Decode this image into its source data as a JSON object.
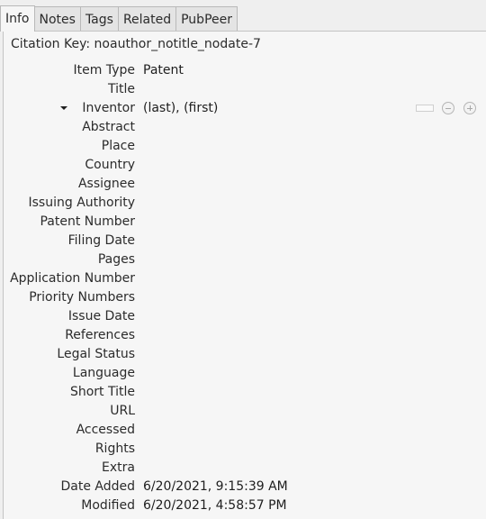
{
  "tabs": [
    {
      "label": "Info",
      "active": true
    },
    {
      "label": "Notes",
      "active": false
    },
    {
      "label": "Tags",
      "active": false
    },
    {
      "label": "Related",
      "active": false
    },
    {
      "label": "PubPeer",
      "active": false
    }
  ],
  "citation": {
    "label": "Citation Key:",
    "value": "noauthor_notitle_nodate-7"
  },
  "fields": [
    {
      "label": "Item Type",
      "value": "Patent"
    },
    {
      "label": "Title",
      "value": ""
    },
    {
      "label": "Inventor",
      "value": "(last), (first)"
    },
    {
      "label": "Abstract",
      "value": ""
    },
    {
      "label": "Place",
      "value": ""
    },
    {
      "label": "Country",
      "value": ""
    },
    {
      "label": "Assignee",
      "value": ""
    },
    {
      "label": "Issuing Authority",
      "value": ""
    },
    {
      "label": "Patent Number",
      "value": ""
    },
    {
      "label": "Filing Date",
      "value": ""
    },
    {
      "label": "Pages",
      "value": ""
    },
    {
      "label": "Application Number",
      "value": ""
    },
    {
      "label": "Priority Numbers",
      "value": ""
    },
    {
      "label": "Issue Date",
      "value": ""
    },
    {
      "label": "References",
      "value": ""
    },
    {
      "label": "Legal Status",
      "value": ""
    },
    {
      "label": "Language",
      "value": ""
    },
    {
      "label": "Short Title",
      "value": ""
    },
    {
      "label": "URL",
      "value": ""
    },
    {
      "label": "Accessed",
      "value": ""
    },
    {
      "label": "Rights",
      "value": ""
    },
    {
      "label": "Extra",
      "value": ""
    },
    {
      "label": "Date Added",
      "value": "6/20/2021, 9:15:39 AM"
    },
    {
      "label": "Modified",
      "value": "6/20/2021, 4:58:57 PM"
    }
  ],
  "icons": {
    "creator_menu": "dropdown-triangle-icon",
    "mode_switch": "name-mode-switch-icon",
    "remove": "minus-circle-icon",
    "add": "plus-circle-icon"
  }
}
